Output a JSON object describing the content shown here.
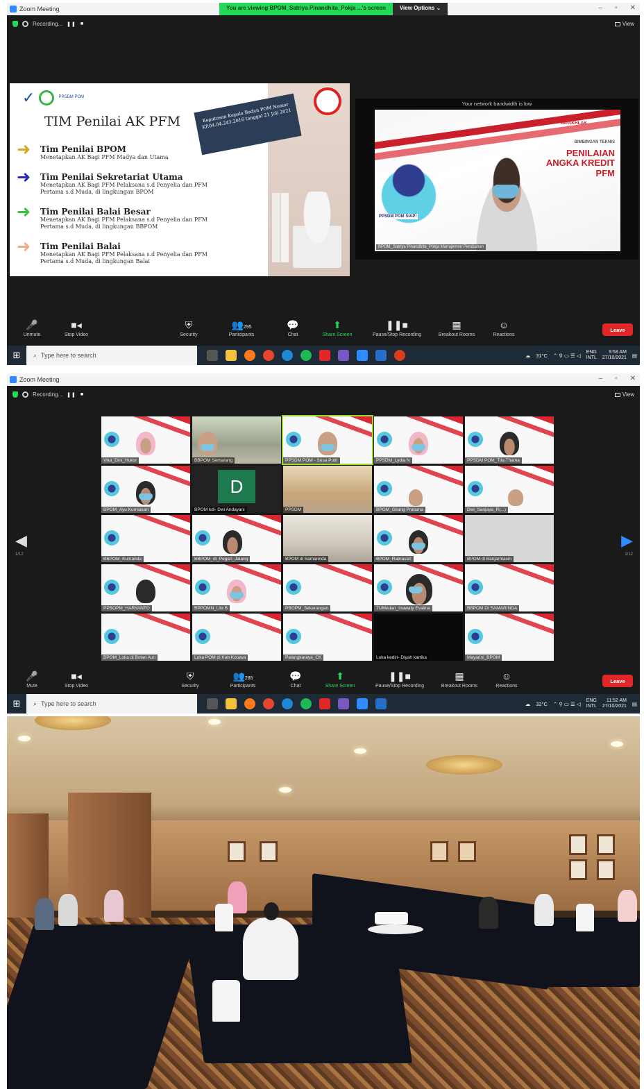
{
  "panel1": {
    "titlebar": {
      "app_title": "Zoom Meeting",
      "viewing": "You are viewing BPOM_Satriya Pinandhita_Pokja ...'s screen",
      "view_options": "View Options ⌄",
      "minimize": "–",
      "restore": "▫",
      "close": "✕"
    },
    "recording": {
      "label": "Recording...",
      "pause": "❚❚",
      "stop": "■"
    },
    "view_btn": "View",
    "slide": {
      "logo_text": "PPSDM POM",
      "title": "TIM Penilai AK PFM",
      "note": "Keputusan Kepala Badan POM Nomor KP.04.04.243.2016 tanggal 21 Juli 2021",
      "items": [
        {
          "head": "Tim Penilai BPOM",
          "desc": "Menetapkan AK Bagi PFM Madya dan Utama",
          "arrow_color": "#d9a81e"
        },
        {
          "head": "Tim Penilai Sekretariat Utama",
          "desc": "Menetapkan AK Bagi PFM Pelaksana s.d Penyelia dan PFM Pertama s.d Muda, di lingkungan BPOM",
          "arrow_color": "#2a2ab8"
        },
        {
          "head": "Tim Penilai Balai Besar",
          "desc": "Menetapkan AK Bagi PFM Pelaksana s.d Penyelia dan PFM Pertama s.d Muda, di lingkungan BBPOM",
          "arrow_color": "#3fbf3f"
        },
        {
          "head": "Tim Penilai Balai",
          "desc": "Menetapkan AK Bagi PFM Pelaksana s.d Penyelia dan PFM Pertama s.d Muda, di lingkungan Balai",
          "arrow_color": "#f0a98a"
        }
      ]
    },
    "speaker": {
      "bandwidth": "Your network bandwidth is low",
      "brand": "BerAKHLAK",
      "sub": "BIMBINGAN TEKNIS",
      "line1": "PENILAIAN",
      "line2": "ANGKA KREDIT",
      "line3": "PFM",
      "mascot_label": "PPSDM POM SIAP!",
      "name": "BPOM_Satriya Pinandhita_Pokja Manajemen Perubahan"
    },
    "toolbar": {
      "unmute": "Unmute",
      "stop_video": "Stop Video",
      "security": "Security",
      "participants": "Participants",
      "participants_count": "295",
      "chat": "Chat",
      "share": "Share Screen",
      "record": "Pause/Stop Recording",
      "breakout": "Breakout Rooms",
      "reactions": "Reactions",
      "leave": "Leave"
    },
    "taskbar": {
      "search": "Type here to search",
      "weather": "31°C",
      "lang1": "ENG",
      "lang2": "INTL",
      "time": "9:58 AM",
      "date": "27/10/2021"
    }
  },
  "panel2": {
    "titlebar": {
      "app_title": "Zoom Meeting"
    },
    "recording": {
      "label": "Recording..."
    },
    "view_btn": "View",
    "page_left": "1/12",
    "page_right": "1/12",
    "tiles": [
      "Vika_Dini_Hukor",
      "BBPOM Semarang",
      "PPSDM POM - Sesa Putri",
      "PPSDM_Lydia N",
      "PPSDM POM_Tita Thama",
      "BPOM_Ayu Kurniasari",
      "BPOM kdi- Dwi Andayani",
      "PPSDM",
      "BPOM_Gilang Pratama",
      "Dwi_Sanjaya_R(...)",
      "BBPOM_Kumanda",
      "BBPOM_di_Pegan_Jalang",
      "BPOM di Samarinda",
      "BPOM_Ratnasari",
      "BPOM di Banjarmasin",
      "PPBOPM_HARYANTO",
      "BPPOMN_Lila B",
      "PBOPM_Sekarangan",
      "TUMedan_Inawaty Evalina",
      "BBPOM DI SAMARINDA",
      "BPOM_Loka di Bolan Aun",
      "Loka POM di Kab Kotawa",
      "Palangkaraya_CK",
      "Loka kediri- Diyah kartika",
      "Mayarini_BPOM"
    ],
    "initial": "D",
    "toolbar": {
      "mute": "Mute",
      "stop_video": "Stop Video",
      "security": "Security",
      "participants": "Participants",
      "participants_count": "285",
      "chat": "Chat",
      "share": "Share Screen",
      "record": "Pause/Stop Recording",
      "breakout": "Breakout Rooms",
      "reactions": "Reactions",
      "leave": "Leave"
    },
    "taskbar": {
      "search": "Type here to search",
      "weather": "32°C",
      "lang1": "ENG",
      "lang2": "INTL",
      "time": "11:52 AM",
      "date": "27/10/2021"
    }
  }
}
